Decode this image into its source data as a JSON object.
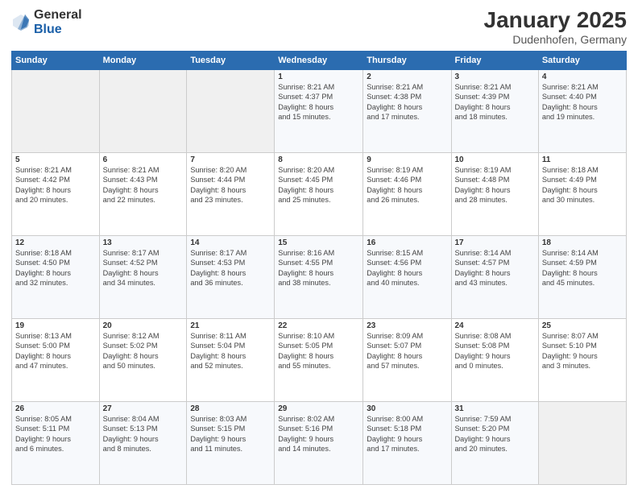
{
  "logo": {
    "general": "General",
    "blue": "Blue"
  },
  "title": "January 2025",
  "subtitle": "Dudenhofen, Germany",
  "headers": [
    "Sunday",
    "Monday",
    "Tuesday",
    "Wednesday",
    "Thursday",
    "Friday",
    "Saturday"
  ],
  "weeks": [
    [
      {
        "day": "",
        "info": ""
      },
      {
        "day": "",
        "info": ""
      },
      {
        "day": "",
        "info": ""
      },
      {
        "day": "1",
        "info": "Sunrise: 8:21 AM\nSunset: 4:37 PM\nDaylight: 8 hours\nand 15 minutes."
      },
      {
        "day": "2",
        "info": "Sunrise: 8:21 AM\nSunset: 4:38 PM\nDaylight: 8 hours\nand 17 minutes."
      },
      {
        "day": "3",
        "info": "Sunrise: 8:21 AM\nSunset: 4:39 PM\nDaylight: 8 hours\nand 18 minutes."
      },
      {
        "day": "4",
        "info": "Sunrise: 8:21 AM\nSunset: 4:40 PM\nDaylight: 8 hours\nand 19 minutes."
      }
    ],
    [
      {
        "day": "5",
        "info": "Sunrise: 8:21 AM\nSunset: 4:42 PM\nDaylight: 8 hours\nand 20 minutes."
      },
      {
        "day": "6",
        "info": "Sunrise: 8:21 AM\nSunset: 4:43 PM\nDaylight: 8 hours\nand 22 minutes."
      },
      {
        "day": "7",
        "info": "Sunrise: 8:20 AM\nSunset: 4:44 PM\nDaylight: 8 hours\nand 23 minutes."
      },
      {
        "day": "8",
        "info": "Sunrise: 8:20 AM\nSunset: 4:45 PM\nDaylight: 8 hours\nand 25 minutes."
      },
      {
        "day": "9",
        "info": "Sunrise: 8:19 AM\nSunset: 4:46 PM\nDaylight: 8 hours\nand 26 minutes."
      },
      {
        "day": "10",
        "info": "Sunrise: 8:19 AM\nSunset: 4:48 PM\nDaylight: 8 hours\nand 28 minutes."
      },
      {
        "day": "11",
        "info": "Sunrise: 8:18 AM\nSunset: 4:49 PM\nDaylight: 8 hours\nand 30 minutes."
      }
    ],
    [
      {
        "day": "12",
        "info": "Sunrise: 8:18 AM\nSunset: 4:50 PM\nDaylight: 8 hours\nand 32 minutes."
      },
      {
        "day": "13",
        "info": "Sunrise: 8:17 AM\nSunset: 4:52 PM\nDaylight: 8 hours\nand 34 minutes."
      },
      {
        "day": "14",
        "info": "Sunrise: 8:17 AM\nSunset: 4:53 PM\nDaylight: 8 hours\nand 36 minutes."
      },
      {
        "day": "15",
        "info": "Sunrise: 8:16 AM\nSunset: 4:55 PM\nDaylight: 8 hours\nand 38 minutes."
      },
      {
        "day": "16",
        "info": "Sunrise: 8:15 AM\nSunset: 4:56 PM\nDaylight: 8 hours\nand 40 minutes."
      },
      {
        "day": "17",
        "info": "Sunrise: 8:14 AM\nSunset: 4:57 PM\nDaylight: 8 hours\nand 43 minutes."
      },
      {
        "day": "18",
        "info": "Sunrise: 8:14 AM\nSunset: 4:59 PM\nDaylight: 8 hours\nand 45 minutes."
      }
    ],
    [
      {
        "day": "19",
        "info": "Sunrise: 8:13 AM\nSunset: 5:00 PM\nDaylight: 8 hours\nand 47 minutes."
      },
      {
        "day": "20",
        "info": "Sunrise: 8:12 AM\nSunset: 5:02 PM\nDaylight: 8 hours\nand 50 minutes."
      },
      {
        "day": "21",
        "info": "Sunrise: 8:11 AM\nSunset: 5:04 PM\nDaylight: 8 hours\nand 52 minutes."
      },
      {
        "day": "22",
        "info": "Sunrise: 8:10 AM\nSunset: 5:05 PM\nDaylight: 8 hours\nand 55 minutes."
      },
      {
        "day": "23",
        "info": "Sunrise: 8:09 AM\nSunset: 5:07 PM\nDaylight: 8 hours\nand 57 minutes."
      },
      {
        "day": "24",
        "info": "Sunrise: 8:08 AM\nSunset: 5:08 PM\nDaylight: 9 hours\nand 0 minutes."
      },
      {
        "day": "25",
        "info": "Sunrise: 8:07 AM\nSunset: 5:10 PM\nDaylight: 9 hours\nand 3 minutes."
      }
    ],
    [
      {
        "day": "26",
        "info": "Sunrise: 8:05 AM\nSunset: 5:11 PM\nDaylight: 9 hours\nand 6 minutes."
      },
      {
        "day": "27",
        "info": "Sunrise: 8:04 AM\nSunset: 5:13 PM\nDaylight: 9 hours\nand 8 minutes."
      },
      {
        "day": "28",
        "info": "Sunrise: 8:03 AM\nSunset: 5:15 PM\nDaylight: 9 hours\nand 11 minutes."
      },
      {
        "day": "29",
        "info": "Sunrise: 8:02 AM\nSunset: 5:16 PM\nDaylight: 9 hours\nand 14 minutes."
      },
      {
        "day": "30",
        "info": "Sunrise: 8:00 AM\nSunset: 5:18 PM\nDaylight: 9 hours\nand 17 minutes."
      },
      {
        "day": "31",
        "info": "Sunrise: 7:59 AM\nSunset: 5:20 PM\nDaylight: 9 hours\nand 20 minutes."
      },
      {
        "day": "",
        "info": ""
      }
    ]
  ]
}
